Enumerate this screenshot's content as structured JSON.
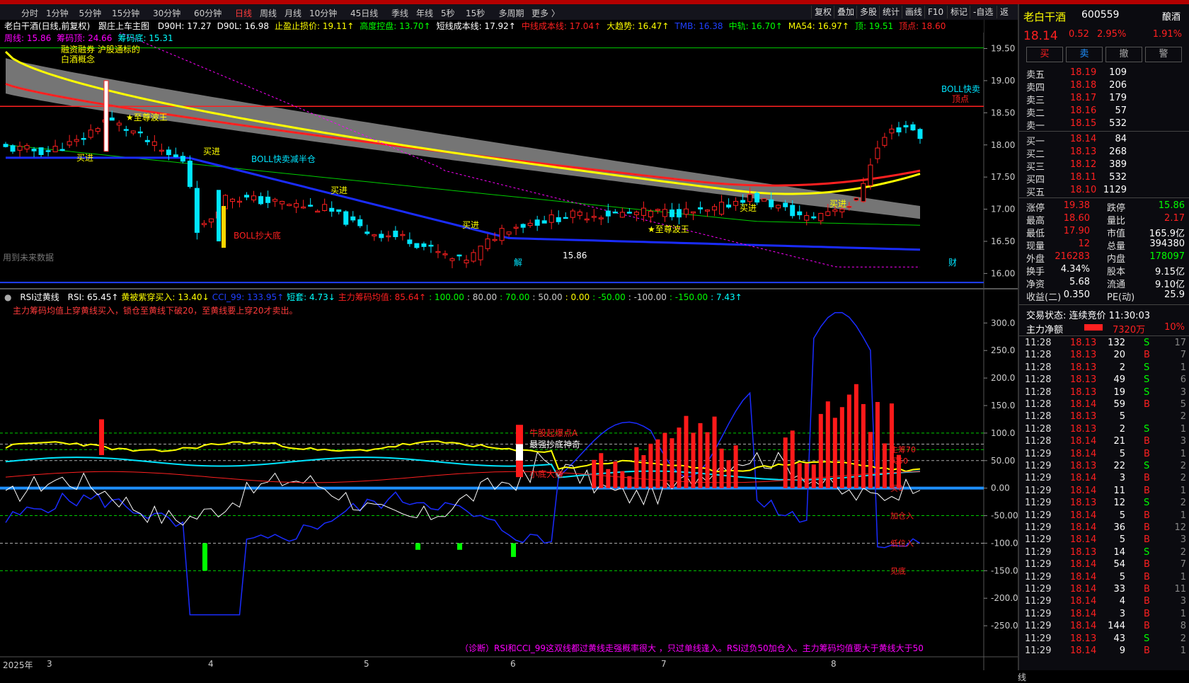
{
  "toolbar": {
    "periods": [
      "分时",
      "1分钟",
      "5分钟",
      "15分钟",
      "30分钟",
      "60分钟",
      "日线",
      "周线",
      "月线",
      "10分钟",
      "45日线",
      "季线",
      "年线",
      "5秒",
      "15秒",
      "多周期",
      "更多 〉"
    ],
    "active_period": "日线",
    "right_buttons": [
      "复权",
      "叠加",
      "多股",
      "统计",
      "画线",
      "F10",
      "标记",
      "-自选",
      "返回"
    ]
  },
  "main_header": {
    "stock": "老白干酒(日线,前复权)",
    "indicator": "跟庄上车主图",
    "items": [
      {
        "label": "D90H: 17.27",
        "color": "#ffffff"
      },
      {
        "label": "D90L: 16.98",
        "color": "#ffffff"
      },
      {
        "label": "止盈止损价: 19.11↑",
        "color": "#ffff00"
      },
      {
        "label": "高度控盘: 13.70↑",
        "color": "#00ff00"
      },
      {
        "label": "短线成本线: 17.92↑",
        "color": "#ffffff"
      },
      {
        "label": "中线成本线: 17.04↑",
        "color": "#ff2020"
      },
      {
        "label": "大趋势: 16.47↑",
        "color": "#ffff00"
      },
      {
        "label": "TMB: 16.38",
        "color": "#2040ff"
      },
      {
        "label": "中轨: 16.70↑",
        "color": "#00ff00"
      },
      {
        "label": "MA54: 16.97↑",
        "color": "#ffff00"
      },
      {
        "label": "顶: 19.51",
        "color": "#00ff00"
      },
      {
        "label": "顶点: 18.60",
        "color": "#ff2020"
      }
    ],
    "line2": [
      {
        "label": "周线: 15.86",
        "color": "#ff00ff"
      },
      {
        "label": "筹码顶: 24.66",
        "color": "#ff00ff"
      },
      {
        "label": "筹码底: 15.31",
        "color": "#00ffff"
      }
    ]
  },
  "main_axis": {
    "labels": [
      "19.50",
      "19.00",
      "18.50",
      "18.00",
      "17.50",
      "17.00",
      "16.50",
      "16.00"
    ],
    "min": 15.85,
    "max": 19.55
  },
  "annotations_main": [
    "融资融券 沪股通标的",
    "白酒概念",
    "★至尊波王",
    "买进",
    "买进",
    "BOLL快卖减半仓",
    "BOLL抄大底",
    "买进",
    "买进",
    "★至尊波王",
    "买进",
    "买进",
    "BOLL快卖",
    "顶点",
    "15.86",
    "用到未来数据",
    "解",
    "财"
  ],
  "rsi_header": {
    "name": "RSI过黄线",
    "items": [
      {
        "label": "RSI: 65.45↑",
        "color": "#ffffff"
      },
      {
        "label": "黄被紫穿买入: 13.40↓",
        "color": "#ffff00"
      },
      {
        "label": "CCI_99: 133.95↑",
        "color": "#2040ff"
      },
      {
        "label": "短套: 4.73↓",
        "color": "#00ffff"
      },
      {
        "label": "主力筹码均值: 85.64↑",
        "color": "#ff2020"
      },
      {
        "label": ": 100.00",
        "color": "#00ff00"
      },
      {
        "label": ": 80.00",
        "color": "#cccccc"
      },
      {
        "label": ": 70.00",
        "color": "#00ff00"
      },
      {
        "label": ": 50.00",
        "color": "#cccccc"
      },
      {
        "label": ": 0.00",
        "color": "#ffff00"
      },
      {
        "label": ": -50.00",
        "color": "#00ff00"
      },
      {
        "label": ": -100.00",
        "color": "#cccccc"
      },
      {
        "label": ": -150.00",
        "color": "#00ff00"
      },
      {
        "label": ": 7.43↑",
        "color": "#00ffff"
      }
    ],
    "note": "主力筹码均值上穿黄线买入，锁仓至黄线下破20，至黄线要上穿20才卖出。"
  },
  "rsi_axis": {
    "labels": [
      "300.0",
      "250.0",
      "200.0",
      "150.0",
      "100.0",
      "50.00",
      "0.00",
      "-50.00",
      "-100.0",
      "-150.0",
      "-200.0",
      "-250.0"
    ],
    "min": -300,
    "max": 330
  },
  "rsi_right_labels": [
    "主筹70",
    "买50",
    "买0",
    "加仓入",
    "低位入",
    "见底"
  ],
  "rsi_annotations": [
    "牛股起爆点A",
    "最强抄底神奇",
    "小底大赚"
  ],
  "diagnosis": "（诊断）RSI和CCI_99这双线都过黄线走强概率很大 ，只过单线逢入。RSI过负50加仓入。主力筹码均值要大于黄线大于50",
  "x_axis": {
    "labels": [
      "2025年",
      "3",
      "4",
      "5",
      "6",
      "7",
      "8"
    ],
    "right": "日线"
  },
  "quote": {
    "name": "老白干酒",
    "code": "600559",
    "badge": "酿酒",
    "price": "18.14",
    "change": "0.52",
    "pct": "2.95%",
    "side_pct": "1.91%",
    "buttons": [
      "买",
      "卖",
      "撤",
      "警"
    ],
    "asks": [
      [
        "卖五",
        "18.19",
        "109"
      ],
      [
        "卖四",
        "18.18",
        "206"
      ],
      [
        "卖三",
        "18.17",
        "179"
      ],
      [
        "卖二",
        "18.16",
        "57"
      ],
      [
        "卖一",
        "18.15",
        "532"
      ]
    ],
    "bids": [
      [
        "买一",
        "18.14",
        "84"
      ],
      [
        "买二",
        "18.13",
        "268"
      ],
      [
        "买三",
        "18.12",
        "389"
      ],
      [
        "买四",
        "18.11",
        "532"
      ],
      [
        "买五",
        "18.10",
        "1129"
      ]
    ],
    "stats": [
      [
        "涨停",
        "19.38",
        "跌停",
        "15.86"
      ],
      [
        "最高",
        "18.60",
        "量比",
        "2.17"
      ],
      [
        "最低",
        "17.90",
        "市值",
        "165.9亿"
      ],
      [
        "现量",
        "12",
        "总量",
        "394380"
      ],
      [
        "外盘",
        "216283",
        "内盘",
        "178097"
      ],
      [
        "换手",
        "4.34%",
        "股本",
        "9.15亿"
      ],
      [
        "净资",
        "5.68",
        "流通",
        "9.10亿"
      ],
      [
        "收益(二)",
        "0.350",
        "PE(动)",
        "25.9"
      ]
    ],
    "trade_status": "交易状态: 连续竞价 11:30:03",
    "main_net_label": "主力净额",
    "main_net_value": "7320万",
    "main_net_pct": "10%",
    "ticks": [
      [
        "11:28",
        "18.13",
        "132",
        "S",
        "17"
      ],
      [
        "11:28",
        "18.13",
        "20",
        "B",
        "7"
      ],
      [
        "11:28",
        "18.13",
        "2",
        "S",
        "1"
      ],
      [
        "11:28",
        "18.13",
        "49",
        "S",
        "6"
      ],
      [
        "11:28",
        "18.13",
        "19",
        "S",
        "3"
      ],
      [
        "11:28",
        "18.14",
        "59",
        "B",
        "5"
      ],
      [
        "11:28",
        "18.13",
        "5",
        "",
        "2"
      ],
      [
        "11:28",
        "18.13",
        "2",
        "S",
        "1"
      ],
      [
        "11:28",
        "18.14",
        "21",
        "B",
        "3"
      ],
      [
        "11:29",
        "18.14",
        "5",
        "B",
        "1"
      ],
      [
        "11:29",
        "18.13",
        "22",
        "S",
        "2"
      ],
      [
        "11:29",
        "18.14",
        "3",
        "B",
        "2"
      ],
      [
        "11:29",
        "18.14",
        "11",
        "B",
        "1"
      ],
      [
        "11:29",
        "18.13",
        "12",
        "S",
        "2"
      ],
      [
        "11:29",
        "18.14",
        "5",
        "B",
        "1"
      ],
      [
        "11:29",
        "18.14",
        "36",
        "B",
        "12"
      ],
      [
        "11:29",
        "18.14",
        "5",
        "B",
        "3"
      ],
      [
        "11:29",
        "18.13",
        "14",
        "S",
        "2"
      ],
      [
        "11:29",
        "18.14",
        "54",
        "B",
        "7"
      ],
      [
        "11:29",
        "18.14",
        "5",
        "B",
        "1"
      ],
      [
        "11:29",
        "18.14",
        "33",
        "B",
        "11"
      ],
      [
        "11:29",
        "18.14",
        "4",
        "B",
        "3"
      ],
      [
        "11:29",
        "18.14",
        "3",
        "B",
        "1"
      ],
      [
        "11:29",
        "18.14",
        "144",
        "B",
        "8"
      ],
      [
        "11:29",
        "18.13",
        "43",
        "S",
        "2"
      ],
      [
        "11:29",
        "18.14",
        "9",
        "B",
        "1"
      ]
    ]
  },
  "colors": {
    "up": "#ff2020",
    "down": "#00e5ff",
    "bg": "#000000",
    "yellow": "#ffff00",
    "blue": "#1a2cff"
  }
}
